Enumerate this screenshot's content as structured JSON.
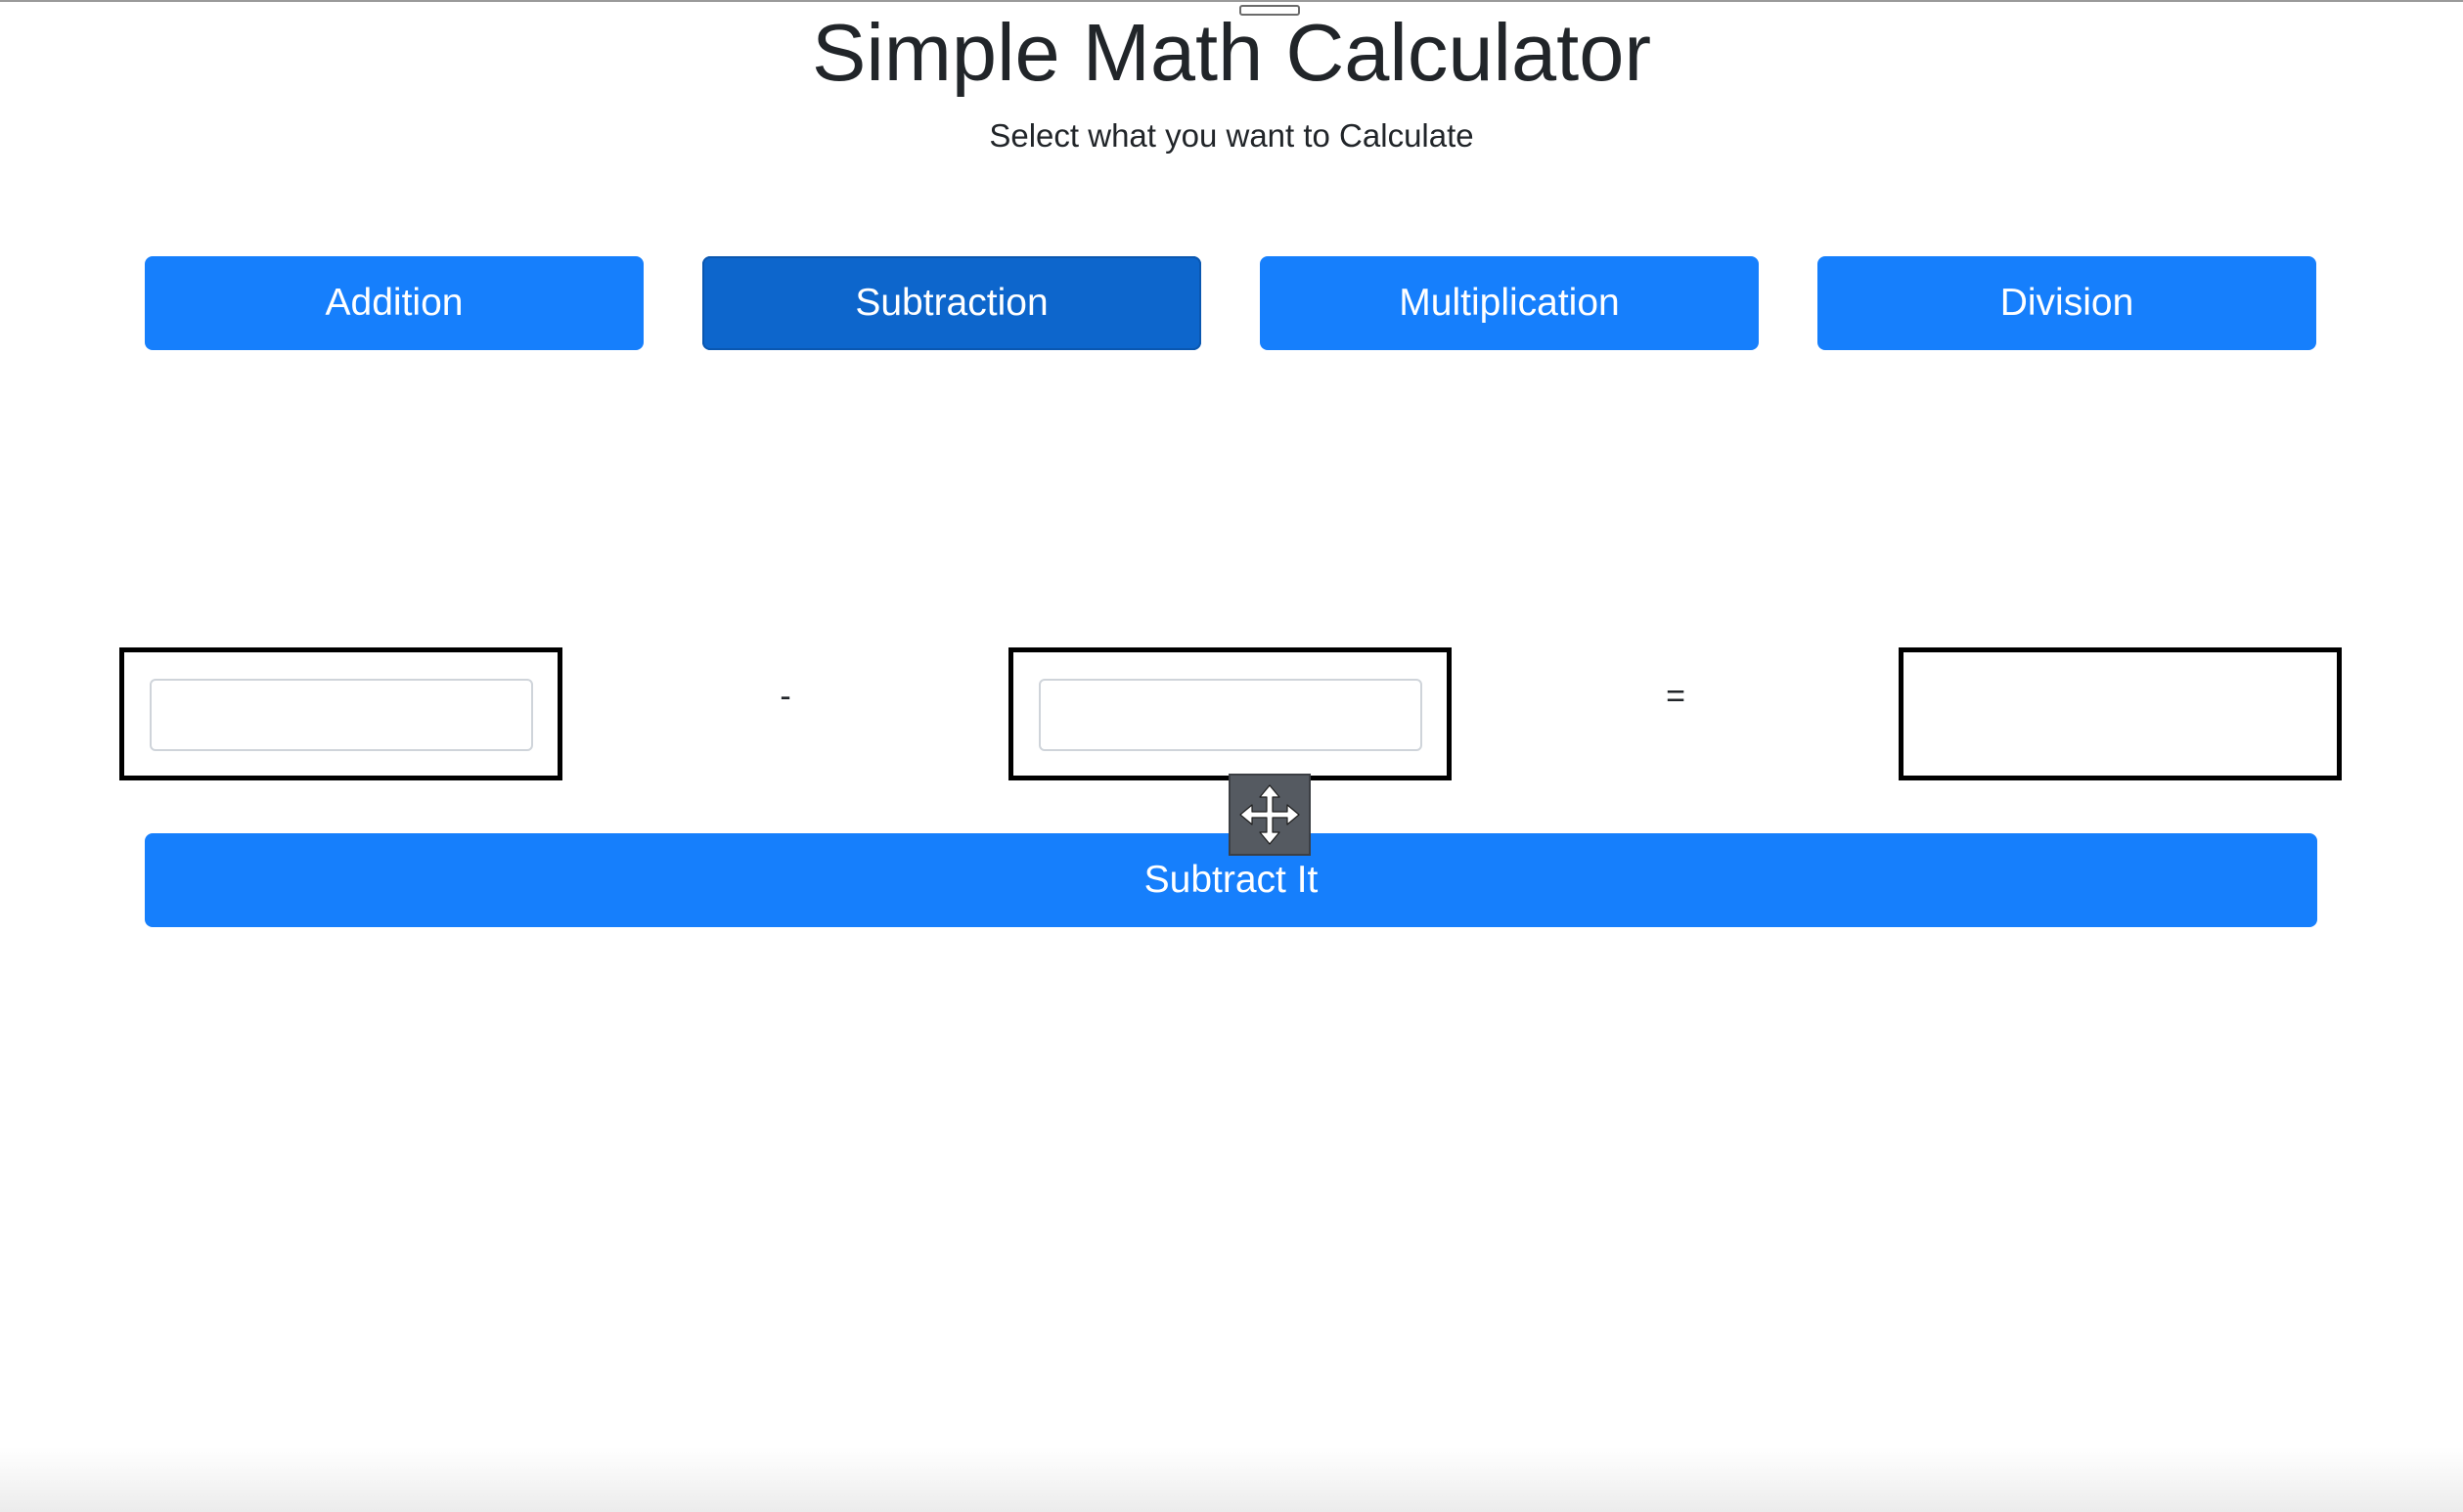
{
  "page": {
    "title": "Simple Math Calculator",
    "subtitle": "Select what you want to Calculate"
  },
  "operations": [
    {
      "label": "Addition",
      "active": false
    },
    {
      "label": "Subtraction",
      "active": true
    },
    {
      "label": "Multiplication",
      "active": false
    },
    {
      "label": "Division",
      "active": false
    }
  ],
  "calculator": {
    "first_value": "",
    "operator_symbol": "-",
    "second_value": "",
    "equals_symbol": "=",
    "result": "",
    "submit_label": "Subtract It"
  },
  "icons": {
    "drag_handle": "move-arrows-icon"
  },
  "colors": {
    "primary": "#167ffc",
    "primary_active": "#0d66cc",
    "box_border": "#000000"
  }
}
